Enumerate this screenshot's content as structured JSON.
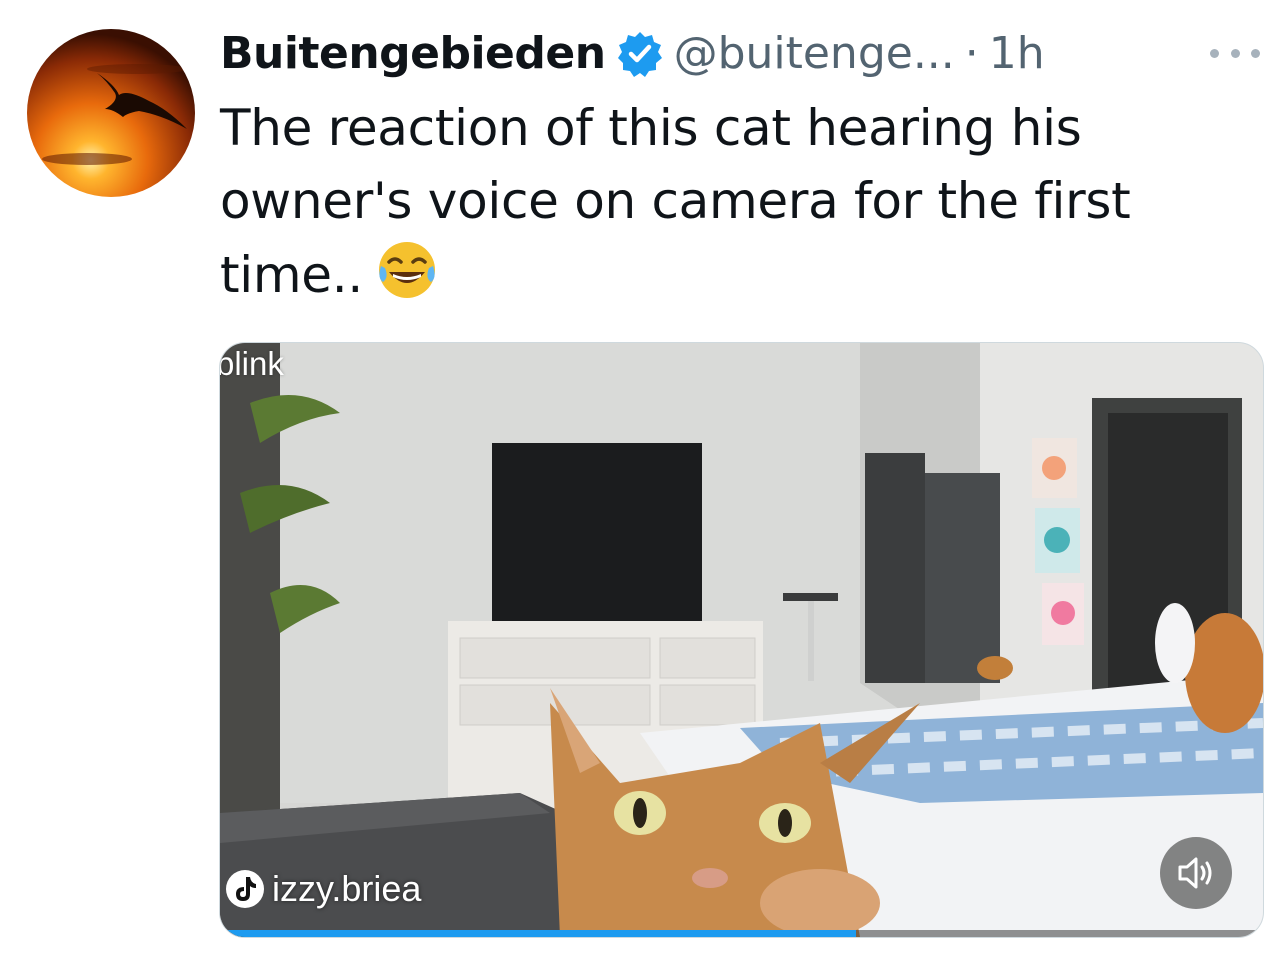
{
  "tweet": {
    "display_name": "Buitengebieden",
    "handle": "@buitenge...",
    "separator": "·",
    "time": "1h",
    "text": "The reaction of this cat hearing his owner's voice on camera for the first time..",
    "emoji": "face-with-tears-of-joy"
  },
  "media": {
    "watermark": "blink",
    "tiktok_user": "izzy.briea",
    "progress": 0.61,
    "volume_state": "muted"
  },
  "colors": {
    "accent": "#1d9bf0",
    "secondary_text": "#536471"
  }
}
